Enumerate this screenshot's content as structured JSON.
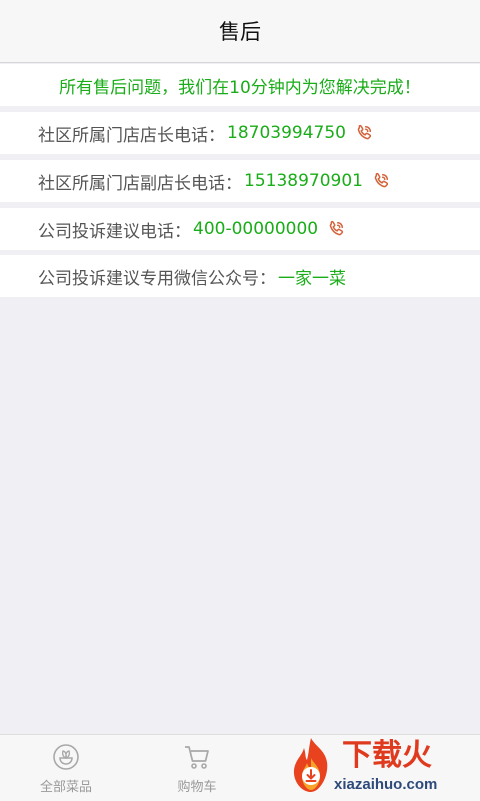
{
  "header": {
    "title": "售后"
  },
  "notice": {
    "text": "所有售后问题，我们在10分钟内为您解决完成！"
  },
  "contacts": [
    {
      "label": "社区所属门店店长电话：",
      "value": "18703994750",
      "icon": "phone-icon"
    },
    {
      "label": "社区所属门店副店长电话：",
      "value": "15138970901",
      "icon": "phone-icon"
    },
    {
      "label": "公司投诉建议电话：",
      "value": "400-00000000",
      "icon": "phone-icon"
    },
    {
      "label": "公司投诉建议专用微信公众号：",
      "value": "一家一菜"
    }
  ],
  "tabbar": {
    "tabs": [
      {
        "label": "全部菜品",
        "icon": "leaf-bowl-icon"
      },
      {
        "label": "购物车",
        "icon": "cart-icon"
      }
    ]
  },
  "watermark": {
    "text": "下载火",
    "url": "xiazaihuo.com"
  },
  "colors": {
    "accent_green": "#1aad19",
    "phone_icon": "#d4623a",
    "background": "#efeff4"
  }
}
